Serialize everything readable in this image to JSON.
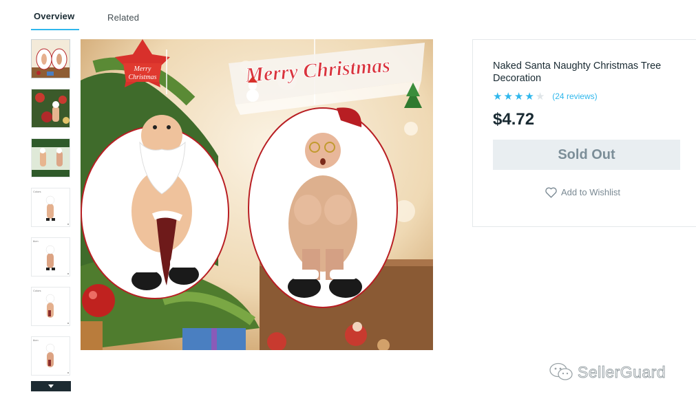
{
  "tabs": [
    {
      "label": "Overview",
      "active": true
    },
    {
      "label": "Related",
      "active": false
    }
  ],
  "thumbnails": [
    {
      "label": ""
    },
    {
      "label": ""
    },
    {
      "label": ""
    },
    {
      "label": "Colors"
    },
    {
      "label": "8cm"
    },
    {
      "label": "Colors"
    },
    {
      "label": "8cm"
    }
  ],
  "main_image": {
    "banner_text": "Merry Christmas",
    "tag_text_1": "Merry",
    "tag_text_2": "Christmas"
  },
  "product": {
    "title": "Naked Santa Naughty Christmas Tree Decoration",
    "rating": 4,
    "rating_max": 5,
    "reviews_label": "(24 reviews)",
    "price": "$4.72",
    "sold_out_label": "Sold Out",
    "wishlist_label": "Add to Wishlist"
  },
  "colors": {
    "accent": "#2fb7ec",
    "text": "#192a32",
    "button_bg": "#e9eef1",
    "button_text": "#7c8e98"
  },
  "icons": {
    "star": "star-icon",
    "wishlist": "heart-icon",
    "scroll": "chevron-down-icon",
    "watermark": "wechat-icon"
  },
  "watermark": {
    "text": "SellerGuard"
  }
}
